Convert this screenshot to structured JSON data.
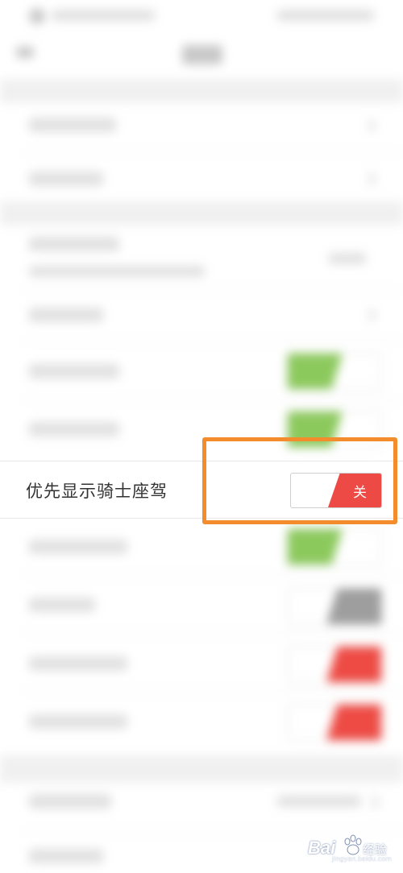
{
  "focused_setting": {
    "label": "优先显示骑士座驾",
    "toggle_text": "关",
    "toggle_state": "off"
  },
  "colors": {
    "switch_off": "#ee4a45",
    "switch_on": "#8cc95d",
    "highlight_box": "#f38c2c"
  },
  "blurred_background": {
    "toggle_states": [
      "on",
      "on",
      "on",
      "gray",
      "off",
      "off"
    ]
  },
  "watermark": {
    "brand": "Bai",
    "brand_suffix": "经验",
    "url": "jingyan.baidu.com"
  }
}
